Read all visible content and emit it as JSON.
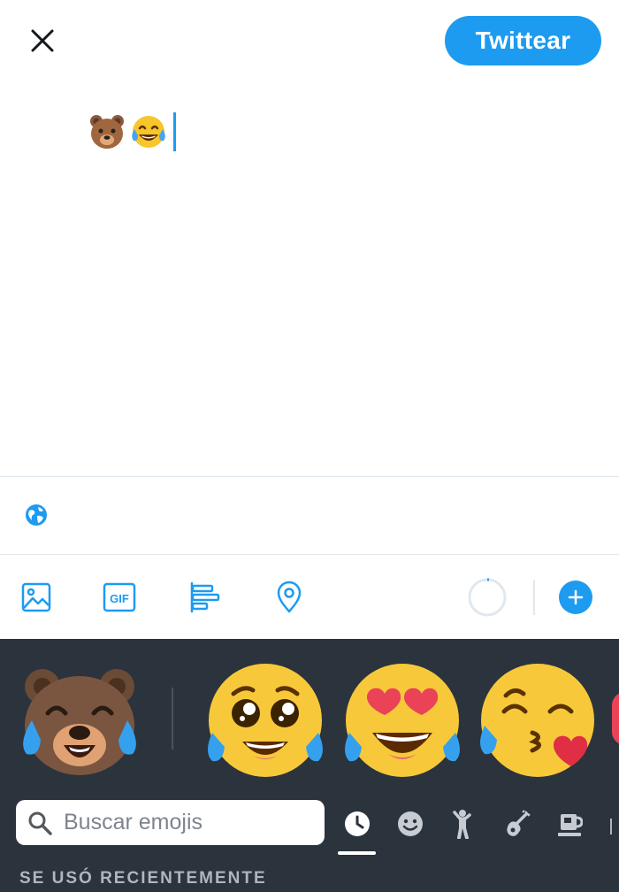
{
  "header": {
    "close_icon": "close-icon",
    "tweet_button_label": "Twittear"
  },
  "composer": {
    "emojis": [
      "bear-face",
      "face-with-tears-of-joy"
    ]
  },
  "reply_settings": {
    "icon": "globe-icon"
  },
  "toolbar": {
    "items": [
      "image-icon",
      "gif-icon",
      "poll-icon",
      "location-icon"
    ],
    "gif_label": "GIF",
    "accent_color": "#1d9bf0"
  },
  "emoji_keyboard": {
    "suggestions": [
      "bear-laughing",
      "pleading-face-tears",
      "heart-eyes-tears",
      "kissing-heart-tears"
    ],
    "search_placeholder": "Buscar emojis",
    "categories": [
      "recent-clock-icon",
      "smiley-icon",
      "person-icon",
      "activity-icon",
      "food-icon"
    ],
    "section_label": "SE USÓ RECIENTEMENTE",
    "background_color": "#2b333d"
  }
}
